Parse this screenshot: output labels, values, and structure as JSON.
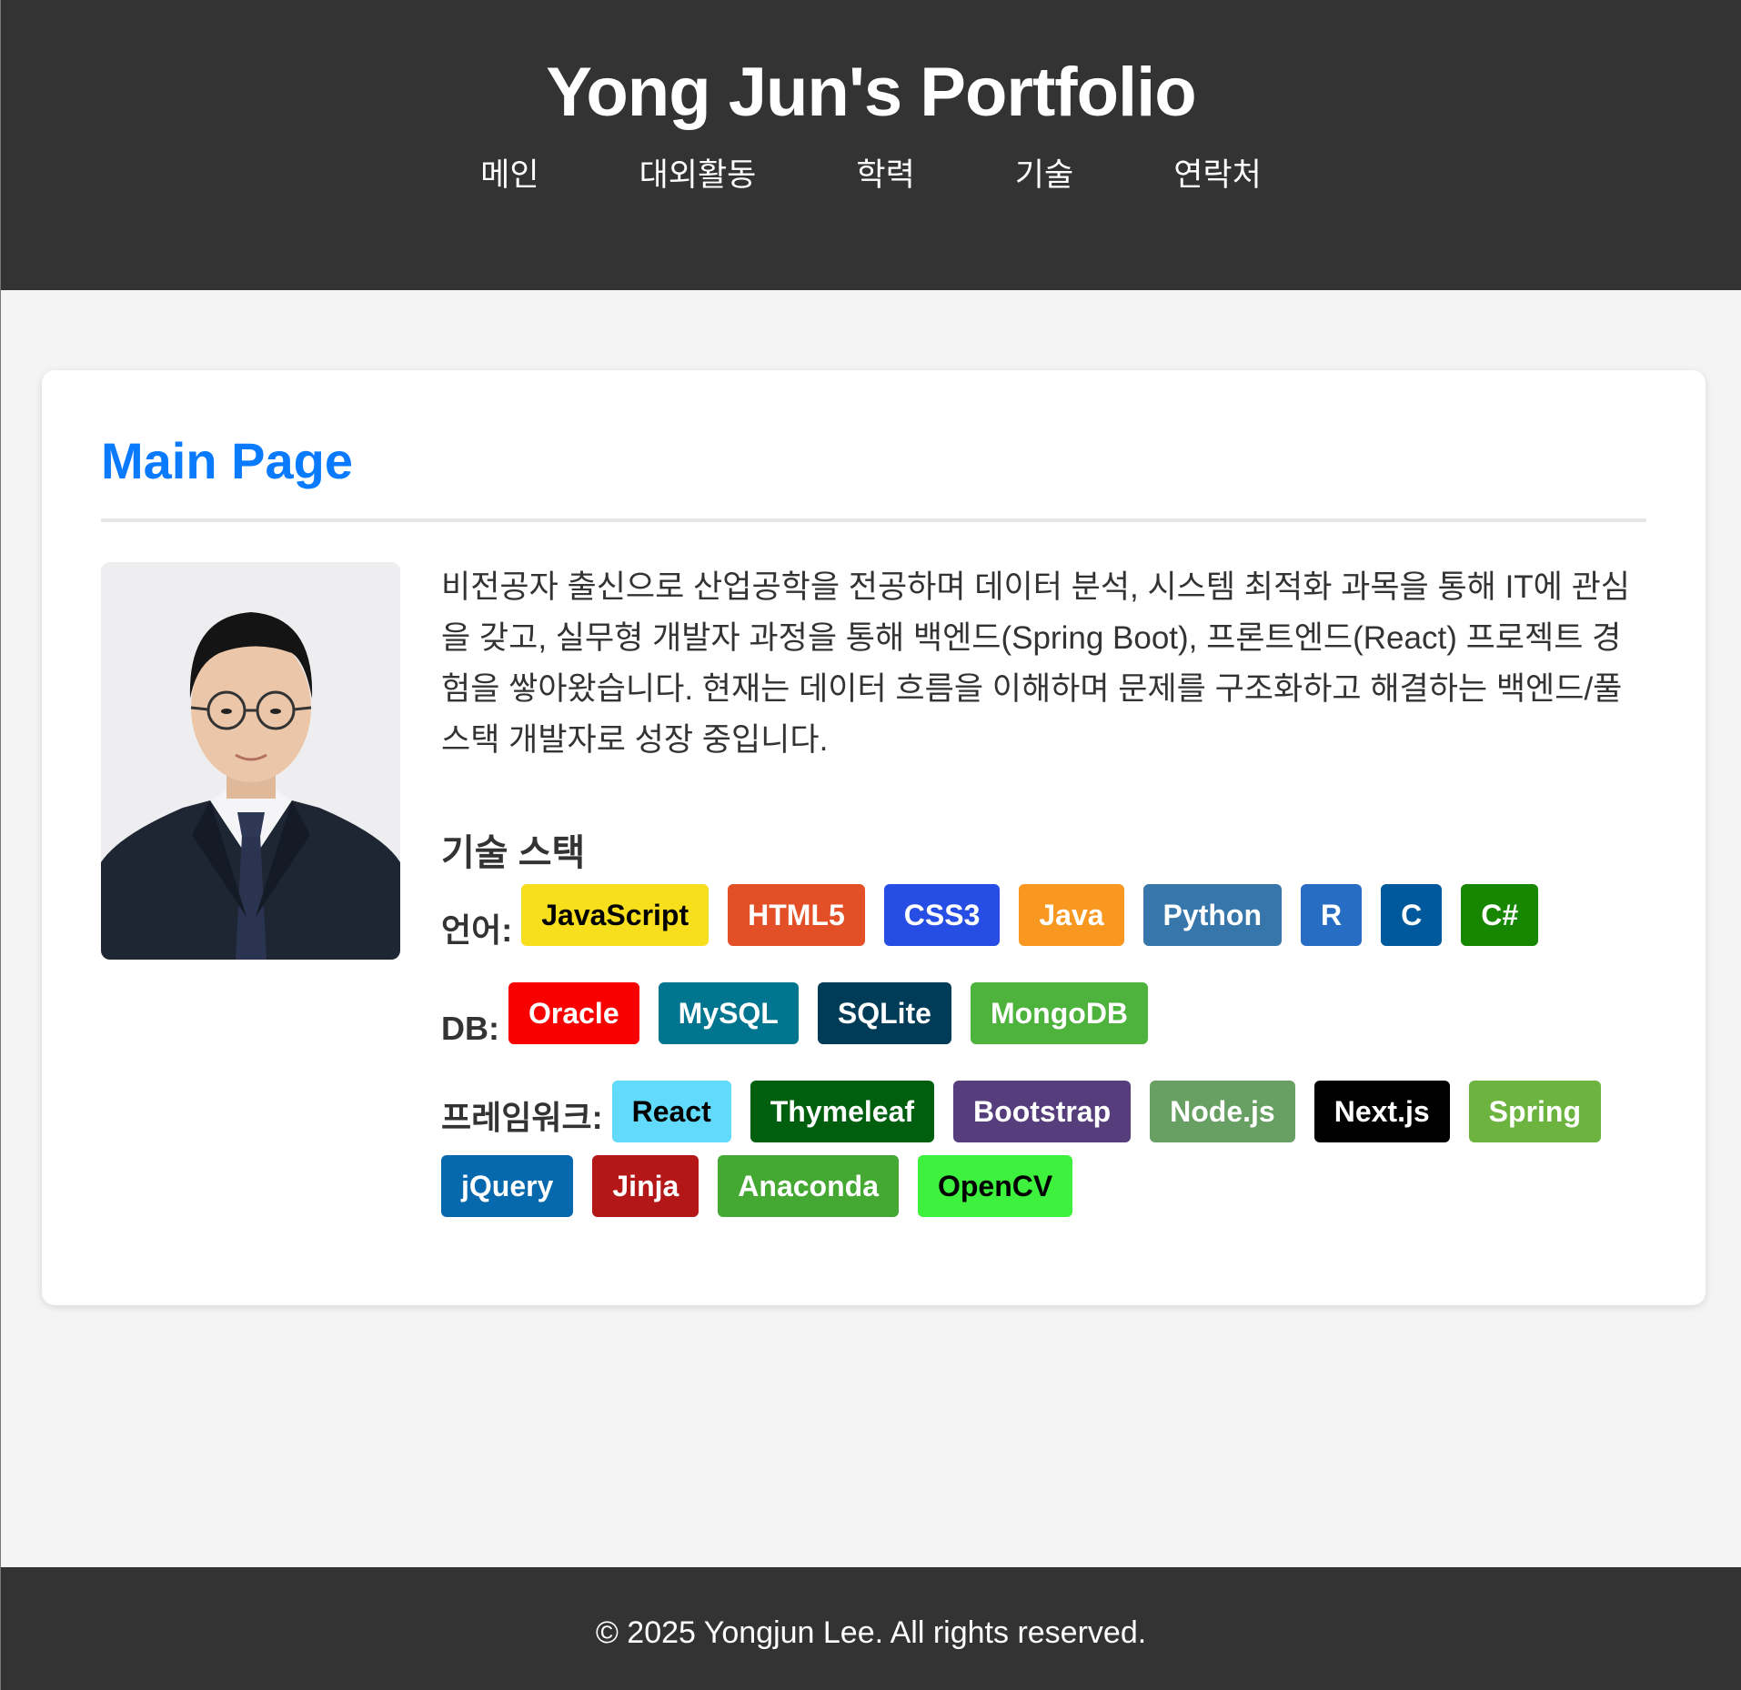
{
  "header": {
    "title": "Yong Jun's Portfolio",
    "nav": [
      "메인",
      "대외활동",
      "학력",
      "기술",
      "연락처"
    ]
  },
  "main": {
    "section_title": "Main Page",
    "photo_alt": "Profile photo",
    "intro": "비전공자 출신으로 산업공학을 전공하며 데이터 분석, 시스템 최적화 과목을 통해 IT에 관심을 갖고, 실무형 개발자 과정을 통해 백엔드(Spring Boot), 프론트엔드(React) 프로젝트 경험을 쌓아왔습니다. 현재는 데이터 흐름을 이해하며 문제를 구조화하고 해결하는 백엔드/풀스택 개발자로 성장 중입니다.",
    "stack_title": "기술 스택",
    "languages": {
      "label": "언어:",
      "items": [
        {
          "name": "JavaScript",
          "bg": "#f7df1e",
          "fg": "#000000"
        },
        {
          "name": "HTML5",
          "bg": "#e34f26",
          "fg": "#ffffff"
        },
        {
          "name": "CSS3",
          "bg": "#264de4",
          "fg": "#ffffff"
        },
        {
          "name": "Java",
          "bg": "#f89820",
          "fg": "#ffffff"
        },
        {
          "name": "Python",
          "bg": "#3776ab",
          "fg": "#ffffff"
        },
        {
          "name": "R",
          "bg": "#276dc3",
          "fg": "#ffffff"
        },
        {
          "name": "C",
          "bg": "#00599c",
          "fg": "#ffffff"
        },
        {
          "name": "C#",
          "bg": "#178600",
          "fg": "#ffffff"
        }
      ]
    },
    "db": {
      "label": "DB:",
      "items": [
        {
          "name": "Oracle",
          "bg": "#f80000",
          "fg": "#ffffff"
        },
        {
          "name": "MySQL",
          "bg": "#00758f",
          "fg": "#ffffff"
        },
        {
          "name": "SQLite",
          "bg": "#003b57",
          "fg": "#ffffff"
        },
        {
          "name": "MongoDB",
          "bg": "#4db33d",
          "fg": "#ffffff"
        }
      ]
    },
    "frameworks": {
      "label": "프레임워크:",
      "items": [
        {
          "name": "React",
          "bg": "#61dafb",
          "fg": "#000000"
        },
        {
          "name": "Thymeleaf",
          "bg": "#005f0f",
          "fg": "#ffffff"
        },
        {
          "name": "Bootstrap",
          "bg": "#563d7c",
          "fg": "#ffffff"
        },
        {
          "name": "Node.js",
          "bg": "#68a063",
          "fg": "#ffffff"
        },
        {
          "name": "Next.js",
          "bg": "#000000",
          "fg": "#ffffff"
        },
        {
          "name": "Spring",
          "bg": "#6db33f",
          "fg": "#ffffff"
        },
        {
          "name": "jQuery",
          "bg": "#0769ad",
          "fg": "#ffffff"
        },
        {
          "name": "Jinja",
          "bg": "#b41717",
          "fg": "#ffffff"
        },
        {
          "name": "Anaconda",
          "bg": "#44a833",
          "fg": "#ffffff"
        },
        {
          "name": "OpenCV",
          "bg": "#3ef13e",
          "fg": "#000000"
        }
      ]
    }
  },
  "footer": {
    "text": "© 2025 Yongjun Lee. All rights reserved."
  }
}
